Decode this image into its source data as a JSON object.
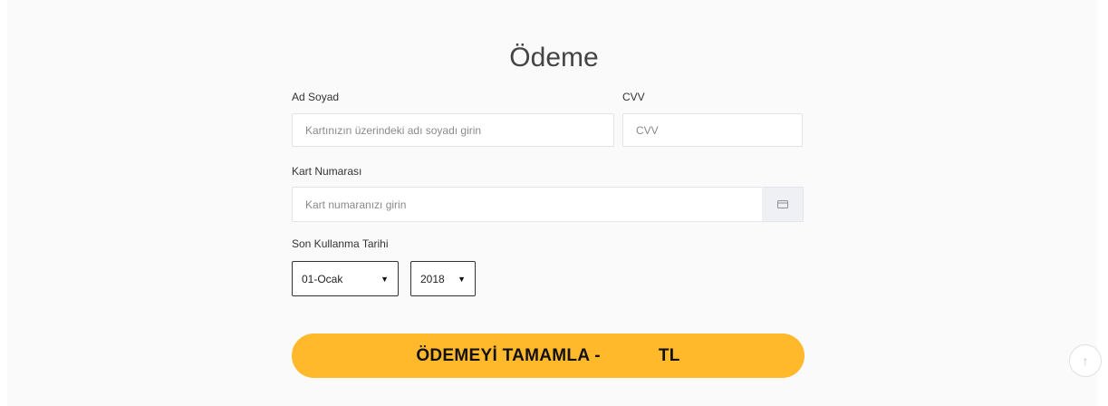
{
  "page": {
    "title": "Ödeme"
  },
  "form": {
    "name_label": "Ad Soyad",
    "name_placeholder": "Kartınızın üzerindeki adı soyadı girin",
    "cvv_label": "CVV",
    "cvv_placeholder": "CVV",
    "card_label": "Kart Numarası",
    "card_placeholder": "Kart numaranızı girin",
    "card_addon_icon": "credit-card-icon",
    "expiry_label": "Son Kullanma Tarihi",
    "month_select": {
      "selected": "01-Ocak"
    },
    "year_select": {
      "selected": "2018"
    },
    "submit_label": "ÖDEMEYİ TAMAMLA -",
    "submit_currency": "TL"
  },
  "scroll_top": {
    "icon": "arrow-up-icon"
  },
  "colors": {
    "accent": "#ffb92a",
    "panel_bg": "#fafafa",
    "input_border": "#e2e5ea"
  }
}
